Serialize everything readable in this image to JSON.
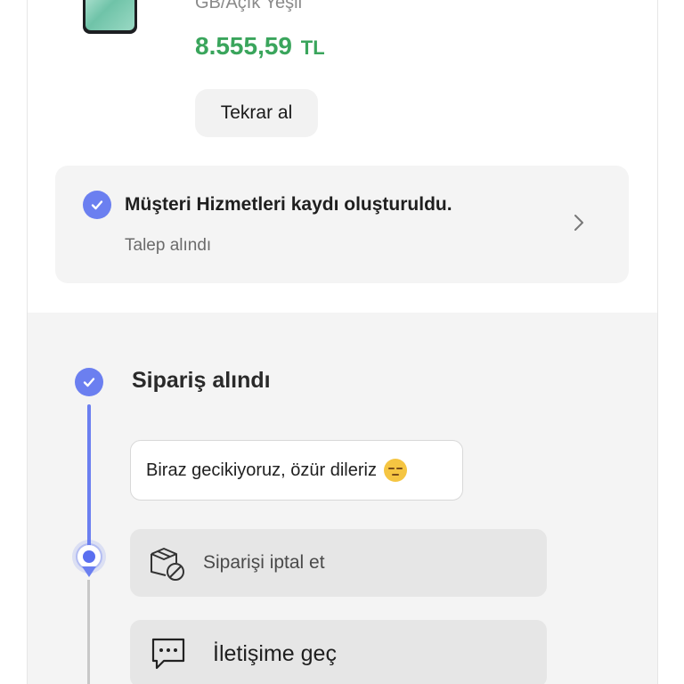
{
  "product": {
    "variant": "GB/Açık Yeşil",
    "price": "8.555,59",
    "currency": "TL",
    "reorder_label": "Tekrar al"
  },
  "customer_service": {
    "title": "Müşteri Hizmetleri kaydı oluşturuldu.",
    "subtitle": "Talep alındı",
    "icons": [
      "check-icon",
      "chevron-right-icon"
    ]
  },
  "timeline": {
    "status_title": "Sipariş alındı",
    "delay_message": "Biraz gecikiyoruz, özür dileriz",
    "cancel_label": "Siparişi iptal et",
    "contact_label": "İletişime geç",
    "icons": [
      "check-icon",
      "box-cancel-icon",
      "chat-bubble-icon"
    ]
  },
  "colors": {
    "accent": "#6b7ff0",
    "price": "#3aa55c"
  }
}
